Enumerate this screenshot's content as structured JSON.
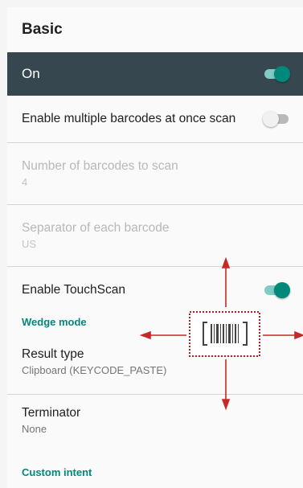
{
  "header": {
    "title": "Basic"
  },
  "master_switch": {
    "label": "On",
    "state": "on"
  },
  "settings": {
    "multi_barcode": {
      "label": "Enable multiple barcodes at once scan",
      "state": "off"
    },
    "num_barcodes": {
      "label": "Number of barcodes to scan",
      "value": "4"
    },
    "separator": {
      "label": "Separator of each barcode",
      "value": "US"
    },
    "touchscan": {
      "label": "Enable TouchScan",
      "state": "on"
    }
  },
  "wedge": {
    "category": "Wedge mode",
    "result_type": {
      "label": "Result type",
      "value": "Clipboard (KEYCODE_PASTE)"
    },
    "terminator": {
      "label": "Terminator",
      "value": "None"
    }
  },
  "custom_intent": {
    "category": "Custom intent"
  },
  "overlay": {
    "icon": "barcode-icon",
    "arrow_color": "#c62828",
    "accent": "#00897b"
  }
}
